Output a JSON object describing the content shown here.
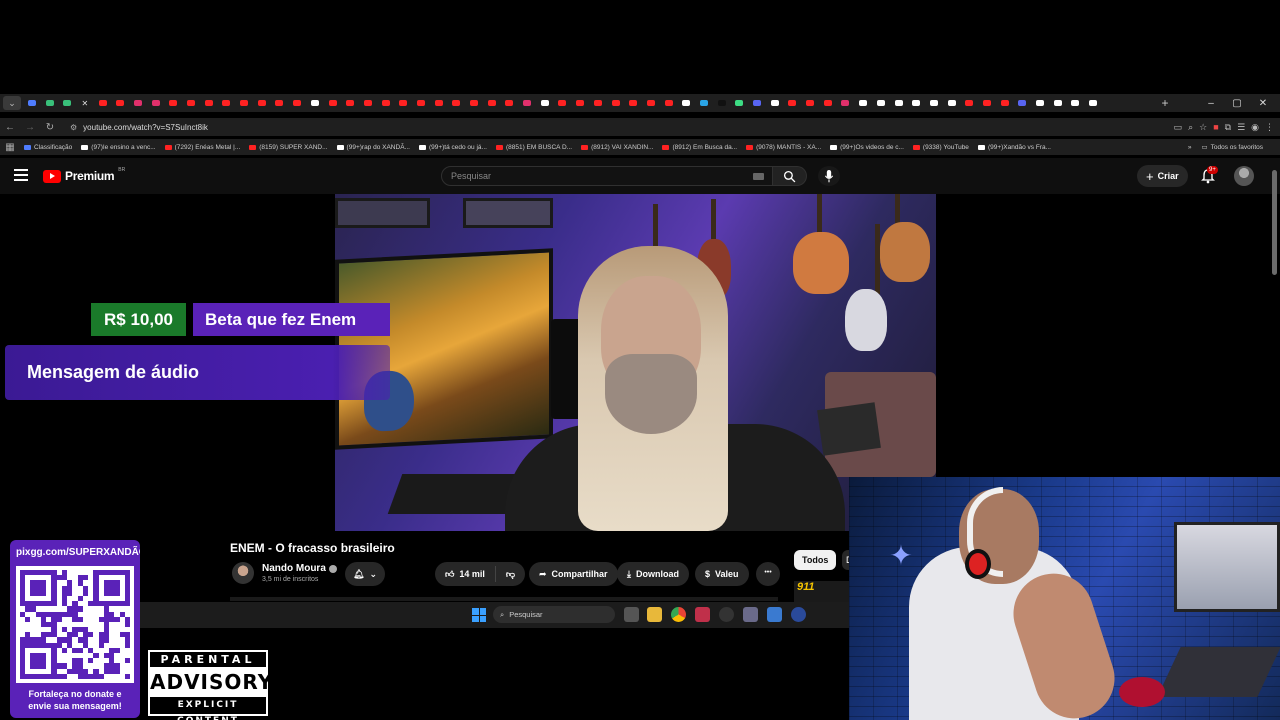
{
  "browser": {
    "tab_favicon_colors": [
      "#4f7dff",
      "#39c07a",
      "#39c07a",
      "#ffffff",
      "#ff2222",
      "#ff2222",
      "#e1306c",
      "#e1306c",
      "#ff2222",
      "#ff2222",
      "#ff2222",
      "#ff2222",
      "#ff2222",
      "#ff2222",
      "#ff2222",
      "#ff2222",
      "#ffffff",
      "#ff2222",
      "#ff2222",
      "#ff2222",
      "#ff2222",
      "#ff2222",
      "#ff2222",
      "#ff2222",
      "#ff2222",
      "#ff2222",
      "#ff2222",
      "#ff2222",
      "#e1306c",
      "#ffffff",
      "#ff2222",
      "#ff2222",
      "#ff2222",
      "#ff2222",
      "#ff2222",
      "#ff2222",
      "#ff2222",
      "#ffffff",
      "#2aa4e6",
      "#111111",
      "#3ddc84",
      "#5865f2",
      "#ffffff",
      "#ff2222",
      "#ff2222",
      "#ff2222",
      "#e1306c",
      "#ffffff",
      "#ffffff",
      "#ffffff",
      "#ffffff",
      "#ffffff",
      "#ffffff",
      "#ff2222",
      "#ff2222",
      "#ff2222",
      "#5865f2",
      "#ffffff",
      "#ffffff",
      "#ffffff",
      "#ffffff"
    ],
    "new_tab_label": "+",
    "window_controls": [
      "–",
      "▢",
      "✕"
    ],
    "url": "youtube.com/watch?v=S7SuInct8ik",
    "bookmarks": [
      {
        "label": "Classificação",
        "color": "#4f7dff"
      },
      {
        "label": "(97)Ie ensino a venc...",
        "color": "#ffffff"
      },
      {
        "label": "(7292) Enéas Metal |...",
        "color": "#ff2222"
      },
      {
        "label": "(8159) SUPER XAND...",
        "color": "#ff2222"
      },
      {
        "label": "(99+)rap do XANDÃ...",
        "color": "#ffffff"
      },
      {
        "label": "(99+)tá cedo ou já...",
        "color": "#ffffff"
      },
      {
        "label": "(8851) EM BUSCA D...",
        "color": "#ff2222"
      },
      {
        "label": "(8912) VAI XANDIN...",
        "color": "#ff2222"
      },
      {
        "label": "(8912) Em Busca da...",
        "color": "#ff2222"
      },
      {
        "label": "(9078) MANTIS - XA...",
        "color": "#ff2222"
      },
      {
        "label": "(99+)Os videos de c...",
        "color": "#ffffff"
      },
      {
        "label": "(9338) YouTube",
        "color": "#ff2222"
      },
      {
        "label": "(99+)Xandão vs Fra...",
        "color": "#ffffff"
      }
    ],
    "bookmarks_more": "»",
    "all_favorites": "Todos os favoritos"
  },
  "youtube": {
    "logo_text": "Premium",
    "logo_region": "BR",
    "search_placeholder": "Pesquisar",
    "create_label": "Criar",
    "notification_badge": "9+"
  },
  "overlay": {
    "donation_amount": "R$ 10,00",
    "donation_title": "Beta que fez Enem",
    "audio_message": "Mensagem de áudio"
  },
  "video": {
    "title": "ENEM - O fracasso brasileiro",
    "channel": "Nando Moura",
    "subscribers": "3,5 mi de inscritos",
    "likes": "14 mil",
    "share_label": "Compartilhar",
    "download_label": "Download",
    "thanks_label": "Valeu",
    "more_label": "•••",
    "chip_all": "Todos",
    "chip_next": "D",
    "thumb_text": "911"
  },
  "taskbar": {
    "search_label": "Pesquisar"
  },
  "qr_card": {
    "url": "pixgg.com/SUPERXANDÃO",
    "caption_line1": "Fortaleça no donate e",
    "caption_line2": "envie sua mensagem!"
  },
  "advisory": {
    "top": "PARENTAL",
    "middle": "ADVISORY",
    "bottom": "EXPLICIT CONTENT"
  },
  "colors": {
    "youtube_red": "#ff0000",
    "donation_green": "#1a7a2a",
    "overlay_purple": "#5a22b8",
    "chrome_bg": "#1f1f1f",
    "yt_bg": "#0f0f0f"
  }
}
